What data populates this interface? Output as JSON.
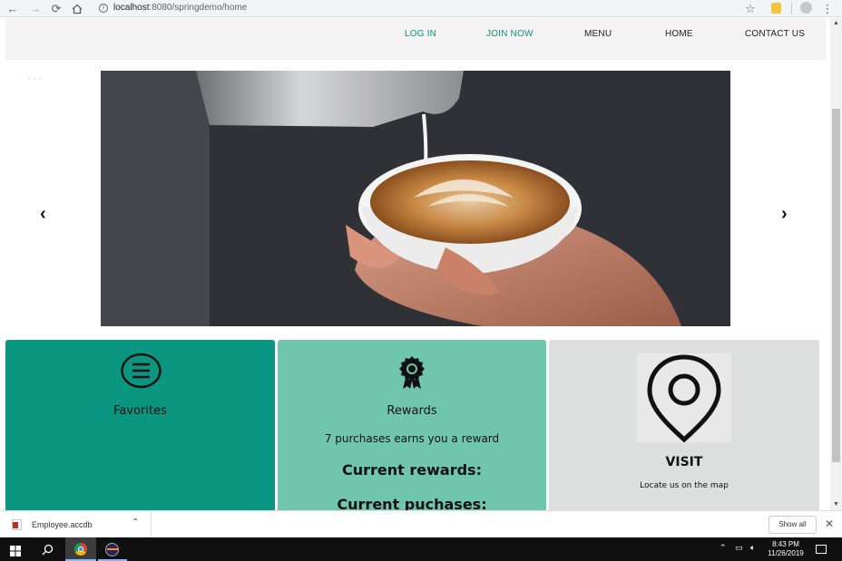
{
  "browser": {
    "url_host": "localhost",
    "url_path": ":8080/springdemo/home"
  },
  "nav": {
    "login": "LOG IN",
    "join": "JOIN NOW",
    "menu": "MENU",
    "home": "HOME",
    "contact": "CONTACT US"
  },
  "cards": {
    "favorites": {
      "title": "Favorites"
    },
    "rewards": {
      "title": "Rewards",
      "subtitle": "7 purchases earns you a reward",
      "current_rewards": "Current rewards:",
      "current_purchases": "Current puchases:"
    },
    "visit": {
      "title": "VISIT",
      "subtitle": "Locate us on the map"
    }
  },
  "downloads": {
    "file_name": "Employee.accdb",
    "show_all": "Show all"
  },
  "taskbar": {
    "time": "8:43 PM",
    "date": "11/26/2019"
  },
  "colors": {
    "teal_dark": "#0a9680",
    "teal_light": "#70c5ad",
    "grey_card": "#dddede",
    "nav_teal": "#138f7c"
  }
}
